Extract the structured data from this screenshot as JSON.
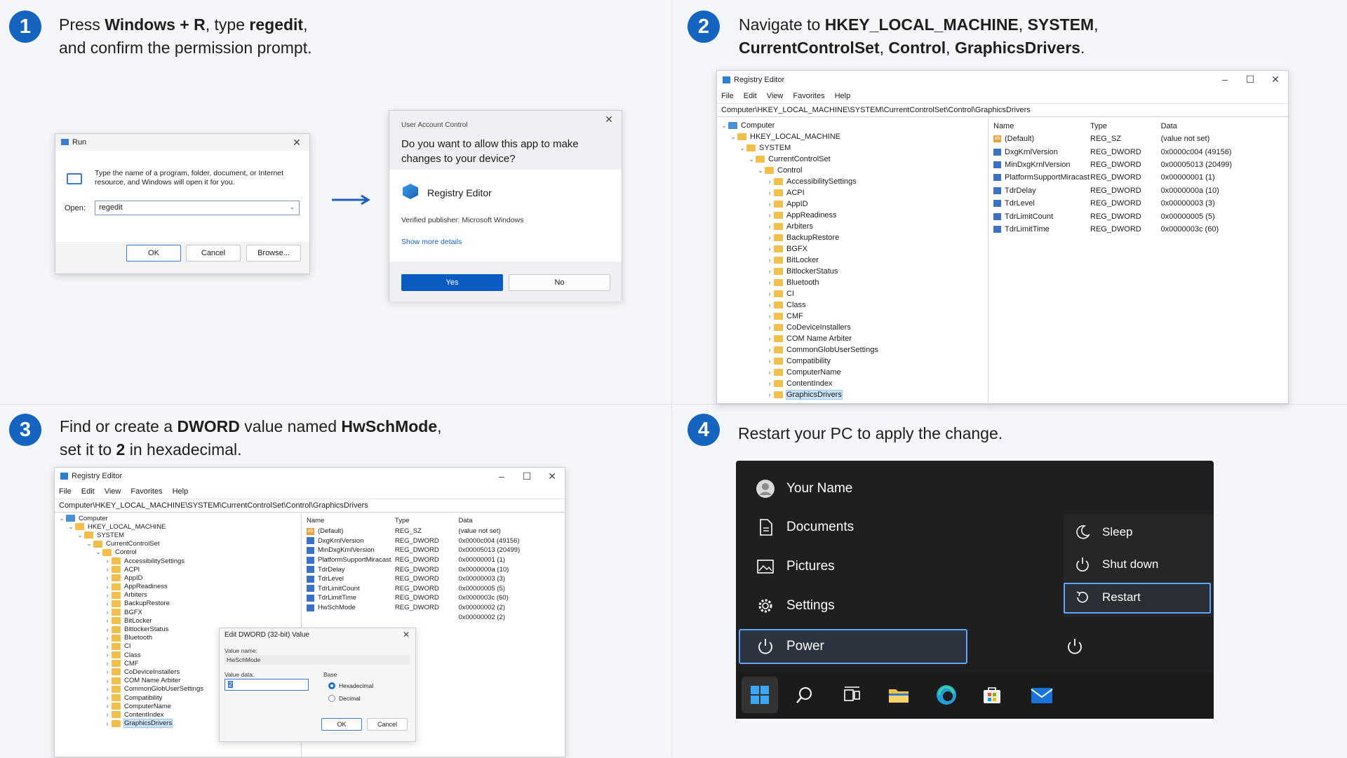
{
  "steps": [
    {
      "num": "1",
      "parts": [
        [
          "Press ",
          false
        ],
        [
          "Windows + R",
          true
        ],
        [
          ", type ",
          false
        ],
        [
          "regedit",
          true
        ],
        [
          ",",
          false
        ],
        [
          "\n",
          false
        ],
        [
          "and confirm the permission prompt.",
          false
        ]
      ]
    },
    {
      "num": "2",
      "parts": [
        [
          "Navigate to ",
          false
        ],
        [
          "HKEY_LOCAL_MACHINE",
          true
        ],
        [
          ", ",
          false
        ],
        [
          "SYSTEM",
          true
        ],
        [
          ",",
          false
        ],
        [
          "\n",
          false
        ],
        [
          "CurrentControlSet",
          true
        ],
        [
          ", ",
          false
        ],
        [
          "Control",
          true
        ],
        [
          ", ",
          false
        ],
        [
          "GraphicsDrivers",
          true
        ],
        [
          ".",
          false
        ]
      ]
    },
    {
      "num": "3",
      "parts": [
        [
          "Find or create a ",
          false
        ],
        [
          "DWORD",
          true
        ],
        [
          " value named ",
          false
        ],
        [
          "HwSchMode",
          true
        ],
        [
          ",",
          false
        ],
        [
          "\n",
          false
        ],
        [
          "set it to ",
          false
        ],
        [
          "2",
          true
        ],
        [
          " in hexadecimal.",
          false
        ]
      ]
    },
    {
      "num": "4",
      "parts": [
        [
          "Restart your PC to apply the change.",
          false
        ]
      ]
    }
  ],
  "run": {
    "title": "Run",
    "desc": "Type the name of a program, folder, document, or Internet resource, and Windows will open it for you.",
    "open_label": "Open:",
    "value": "regedit",
    "ok": "OK",
    "cancel": "Cancel",
    "browse": "Browse..."
  },
  "uac": {
    "title": "User Account Control",
    "question": "Do you want to allow this app to make changes to your device?",
    "app": "Registry Editor",
    "publisher": "Verified publisher: Microsoft Windows",
    "details": "Show more details",
    "yes": "Yes",
    "no": "No"
  },
  "regedit": {
    "title": "Registry Editor",
    "menu": [
      "File",
      "Edit",
      "View",
      "Favorites",
      "Help"
    ],
    "address": "Computer\\HKEY_LOCAL_MACHINE\\SYSTEM\\CurrentControlSet\\Control\\GraphicsDrivers",
    "tree": [
      {
        "label": "Computer",
        "depth": 0,
        "exp": true,
        "icon": "comp"
      },
      {
        "label": "HKEY_LOCAL_MACHINE",
        "depth": 1,
        "exp": true
      },
      {
        "label": "SYSTEM",
        "depth": 2,
        "exp": true
      },
      {
        "label": "CurrentControlSet",
        "depth": 3,
        "exp": true
      },
      {
        "label": "Control",
        "depth": 4,
        "exp": true
      },
      {
        "label": "AccessibilitySettings",
        "depth": 5
      },
      {
        "label": "ACPI",
        "depth": 5
      },
      {
        "label": "AppID",
        "depth": 5
      },
      {
        "label": "AppReadiness",
        "depth": 5
      },
      {
        "label": "Arbiters",
        "depth": 5
      },
      {
        "label": "BackupRestore",
        "depth": 5
      },
      {
        "label": "BGFX",
        "depth": 5
      },
      {
        "label": "BitLocker",
        "depth": 5
      },
      {
        "label": "BitlockerStatus",
        "depth": 5
      },
      {
        "label": "Bluetooth",
        "depth": 5
      },
      {
        "label": "CI",
        "depth": 5
      },
      {
        "label": "Class",
        "depth": 5
      },
      {
        "label": "CMF",
        "depth": 5
      },
      {
        "label": "CoDeviceInstallers",
        "depth": 5
      },
      {
        "label": "COM Name Arbiter",
        "depth": 5
      },
      {
        "label": "CommonGlobUserSettings",
        "depth": 5
      },
      {
        "label": "Compatibility",
        "depth": 5
      },
      {
        "label": "ComputerName",
        "depth": 5
      },
      {
        "label": "ContentIndex",
        "depth": 5
      },
      {
        "label": "GraphicsDrivers",
        "depth": 5,
        "selected": true
      }
    ],
    "headers": [
      "Name",
      "Type",
      "Data"
    ],
    "values": [
      {
        "name": "(Default)",
        "type": "REG_SZ",
        "data": "(value not set)",
        "icon": "str"
      },
      {
        "name": "DxgKrnlVersion",
        "type": "REG_DWORD",
        "data": "0x0000c004 (49156)"
      },
      {
        "name": "MinDxgKrnlVersion",
        "type": "REG_DWORD",
        "data": "0x00005013 (20499)"
      },
      {
        "name": "PlatformSupportMiracast",
        "type": "REG_DWORD",
        "data": "0x00000001 (1)"
      },
      {
        "name": "TdrDelay",
        "type": "REG_DWORD",
        "data": "0x0000000a (10)"
      },
      {
        "name": "TdrLevel",
        "type": "REG_DWORD",
        "data": "0x00000003 (3)"
      },
      {
        "name": "TdrLimitCount",
        "type": "REG_DWORD",
        "data": "0x00000005 (5)"
      },
      {
        "name": "TdrLimitTime",
        "type": "REG_DWORD",
        "data": "0x0000003c (60)"
      }
    ],
    "extra_values": [
      {
        "name": "HwSchMode",
        "type": "REG_DWORD",
        "data": "0x00000002 (2)"
      },
      {
        "name": "",
        "type": "",
        "data": "0x00000002 (2)"
      }
    ]
  },
  "dword": {
    "title": "Edit DWORD (32-bit) Value",
    "name_label": "Value name:",
    "name": "HwSchMode",
    "data_label": "Value data:",
    "data": "2",
    "base_label": "Base",
    "hex": "Hexadecimal",
    "dec": "Decimal",
    "ok": "OK",
    "cancel": "Cancel"
  },
  "start": {
    "user": "Your Name",
    "items": [
      "Documents",
      "Pictures",
      "Settings"
    ],
    "power": "Power",
    "sub": [
      "Sleep",
      "Shut down",
      "Restart"
    ]
  },
  "colors": {
    "accent": "#1565c0",
    "uac_yes": "#0b5cc1",
    "menu_bg": "#1f1f1f",
    "menu_highlight": "#2c3440",
    "focus": "#5ea7ff"
  }
}
